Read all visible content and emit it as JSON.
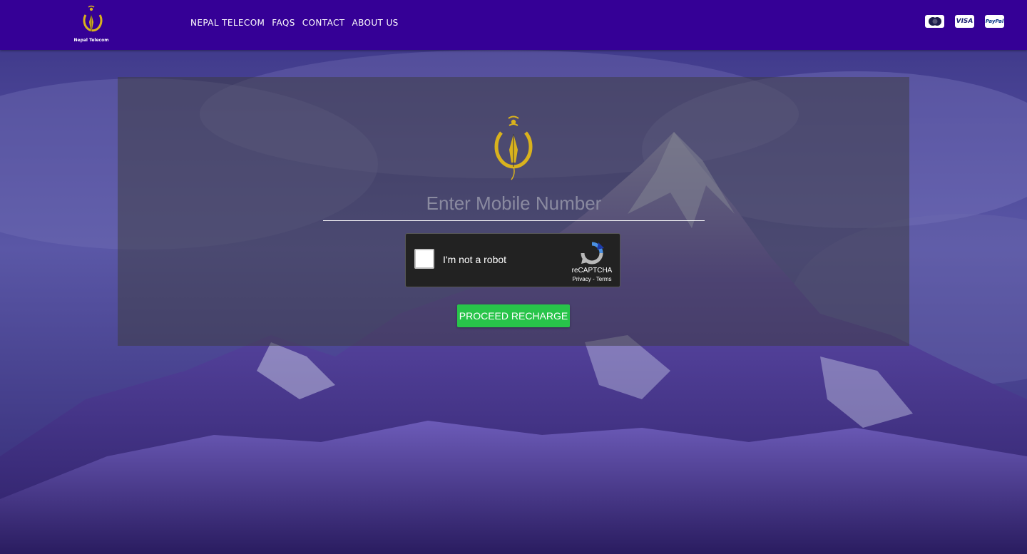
{
  "brand": {
    "name": "Nepal Telecom"
  },
  "nav": {
    "items": [
      {
        "label": "NEPAL TELECOM"
      },
      {
        "label": "FAQS"
      },
      {
        "label": "CONTACT"
      },
      {
        "label": "ABOUT US"
      }
    ]
  },
  "payment_methods": {
    "icons": [
      "mastercard-icon",
      "visa-icon",
      "paypal-icon"
    ],
    "visa_label": "VISA",
    "paypal_label": "PayPal"
  },
  "recharge_form": {
    "mobile_placeholder": "Enter Mobile Number",
    "mobile_value": "",
    "captcha": {
      "label": "I'm not a robot",
      "brand": "reCAPTCHA",
      "links": "Privacy - Terms",
      "checked": false
    },
    "submit_label": "PROCEED RECHARGE"
  },
  "colors": {
    "navbar": "#350096",
    "submit_button": "#28c44a",
    "logo_gold": "#d9b21d"
  }
}
